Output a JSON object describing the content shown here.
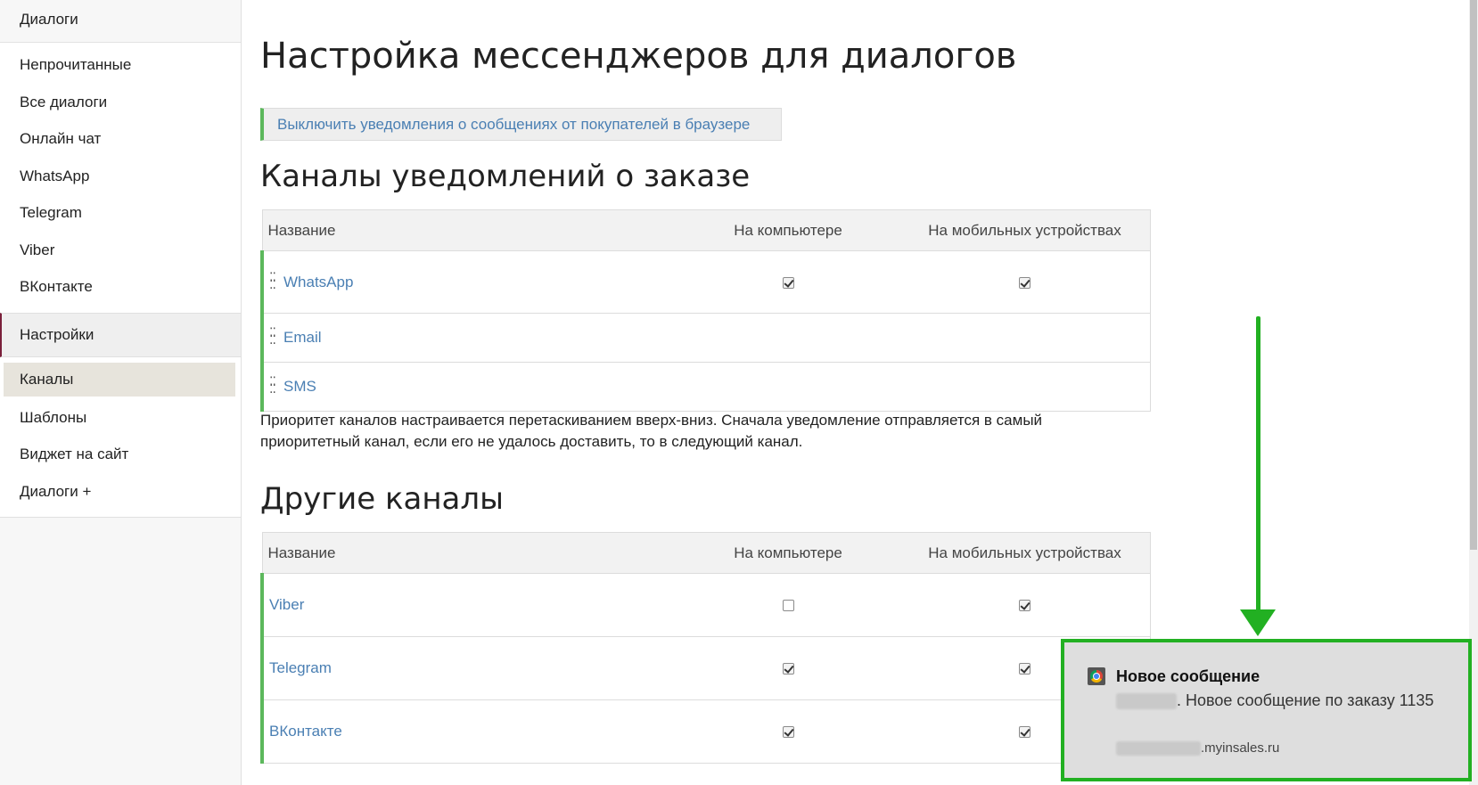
{
  "sidebar": {
    "section_dialogs": "Диалоги",
    "dialog_items": [
      "Непрочитанные",
      "Все диалоги",
      "Онлайн чат",
      "WhatsApp",
      "Telegram",
      "Viber",
      "ВКонтакте"
    ],
    "section_settings": "Настройки",
    "settings_items": [
      "Каналы",
      "Шаблоны",
      "Виджет на сайт",
      "Диалоги +"
    ],
    "active_item": "Каналы"
  },
  "main": {
    "page_title": "Настройка мессенджеров для диалогов",
    "notify_toggle_label": "Выключить уведомления о сообщениях от покупателей в браузере",
    "order_section": {
      "title": "Каналы уведомлений о заказе",
      "columns": [
        "Название",
        "На компьютере",
        "На мобильных устройствах"
      ],
      "rows": [
        {
          "name": "WhatsApp",
          "desktop": true,
          "mobile": true,
          "has_checkboxes": true
        },
        {
          "name": "Email",
          "has_checkboxes": false
        },
        {
          "name": "SMS",
          "has_checkboxes": false
        }
      ],
      "priority_note": "Приоритет каналов настраивается перетаскиванием вверх-вниз. Сначала уведомление отправляется в самый приоритетный канал, если его не удалось доставить, то в следующий канал."
    },
    "other_section": {
      "title": "Другие каналы",
      "columns": [
        "Название",
        "На компьютере",
        "На мобильных устройствах"
      ],
      "rows": [
        {
          "name": "Viber",
          "desktop": false,
          "mobile": true
        },
        {
          "name": "Telegram",
          "desktop": true,
          "mobile": true
        },
        {
          "name": "ВКонтакте",
          "desktop": true,
          "mobile": true
        }
      ]
    }
  },
  "toast": {
    "icon": "chrome-icon",
    "title": "Новое сообщение",
    "body_text": ". Новое сообщение по заказу 1135",
    "site_suffix": ".myinsales.ru"
  },
  "colors": {
    "accent_green": "#5cb85c",
    "link_blue": "#4a7fb3",
    "arrow_green": "#22b022",
    "settings_marker": "#7a1f3a"
  }
}
